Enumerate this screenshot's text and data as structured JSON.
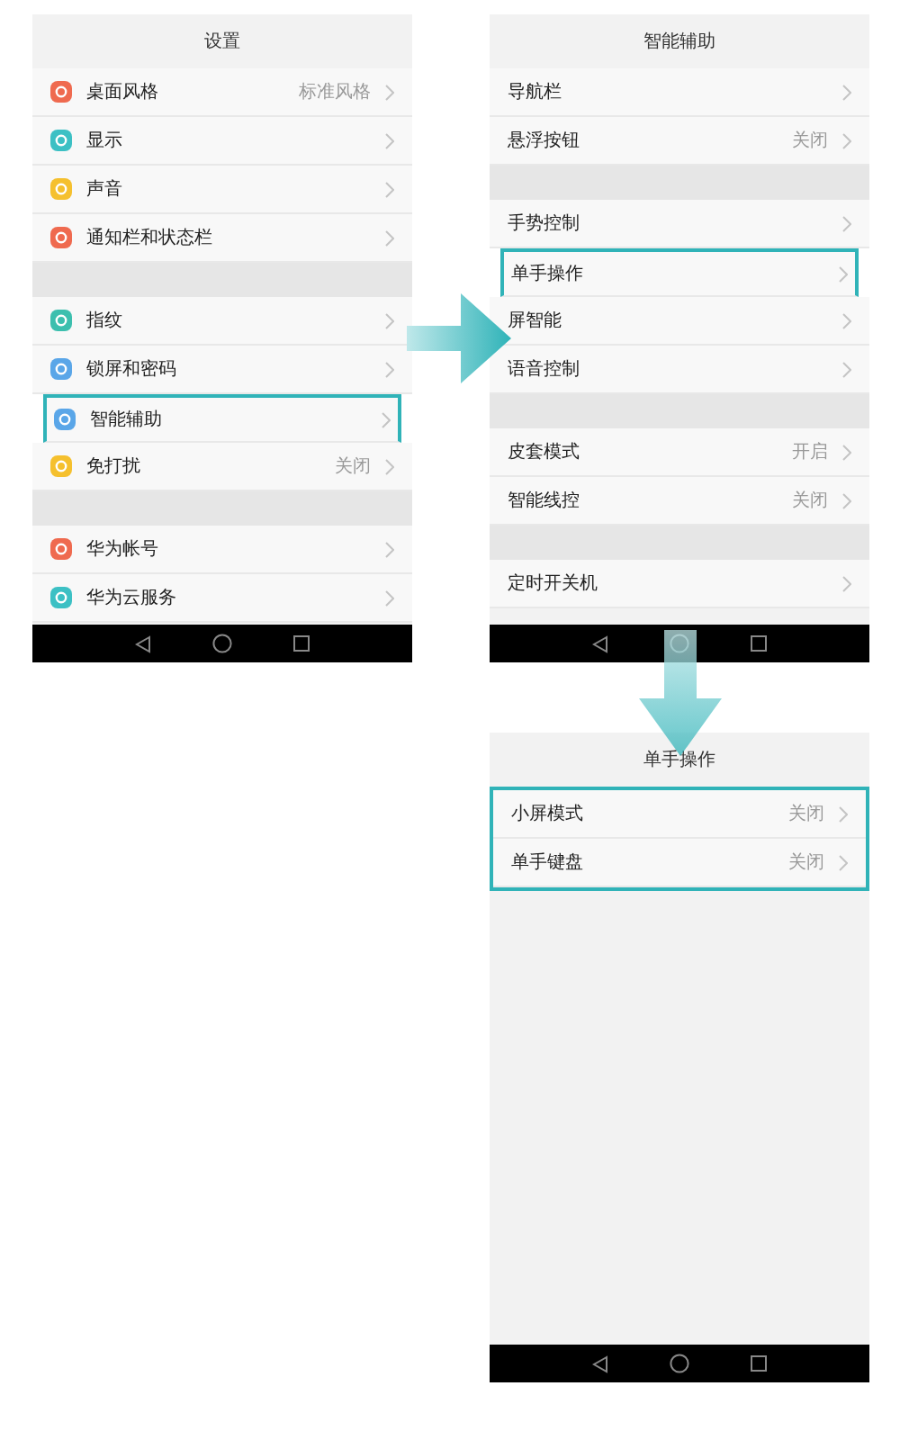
{
  "screens": [
    {
      "title": "设置",
      "sections": [
        {
          "highlighted": false,
          "items": [
            {
              "label": "桌面风格",
              "value": "标准风格",
              "color": "#ef6a4f",
              "highlighted": false
            },
            {
              "label": "显示",
              "color": "#3cc0c4",
              "highlighted": false
            },
            {
              "label": "声音",
              "color": "#f5c02e",
              "highlighted": false
            },
            {
              "label": "通知栏和状态栏",
              "color": "#ef6a4f",
              "highlighted": false
            }
          ]
        },
        {
          "highlighted": false,
          "items": [
            {
              "label": "指纹",
              "color": "#3cbfae",
              "highlighted": false
            },
            {
              "label": "锁屏和密码",
              "color": "#5aa6e8",
              "highlighted": false
            },
            {
              "label": "智能辅助",
              "color": "#5aa6e8",
              "highlighted": true
            },
            {
              "label": "免打扰",
              "value": "关闭",
              "color": "#f5c02e",
              "highlighted": false
            }
          ]
        },
        {
          "highlighted": false,
          "items": [
            {
              "label": "华为帐号",
              "color": "#ef6a4f",
              "highlighted": false
            },
            {
              "label": "华为云服务",
              "color": "#3cc0c4",
              "highlighted": false
            }
          ]
        }
      ]
    },
    {
      "title": "智能辅助",
      "sections": [
        {
          "highlighted": false,
          "items": [
            {
              "label": "导航栏",
              "highlighted": false
            },
            {
              "label": "悬浮按钮",
              "value": "关闭",
              "highlighted": false
            }
          ]
        },
        {
          "highlighted": false,
          "items": [
            {
              "label": "手势控制",
              "highlighted": false
            },
            {
              "label": "单手操作",
              "highlighted": true
            },
            {
              "label": "屏智能",
              "highlighted": false
            },
            {
              "label": "语音控制",
              "highlighted": false
            }
          ]
        },
        {
          "highlighted": false,
          "items": [
            {
              "label": "皮套模式",
              "value": "开启",
              "highlighted": false
            },
            {
              "label": "智能线控",
              "value": "关闭",
              "highlighted": false
            }
          ]
        },
        {
          "highlighted": false,
          "items": [
            {
              "label": "定时开关机",
              "highlighted": false
            }
          ]
        }
      ]
    },
    {
      "title": "单手操作",
      "sections": [
        {
          "highlighted": true,
          "items": [
            {
              "label": "小屏模式",
              "value": "关闭",
              "highlighted": false
            },
            {
              "label": "单手键盘",
              "value": "关闭",
              "highlighted": false
            }
          ]
        }
      ]
    }
  ]
}
